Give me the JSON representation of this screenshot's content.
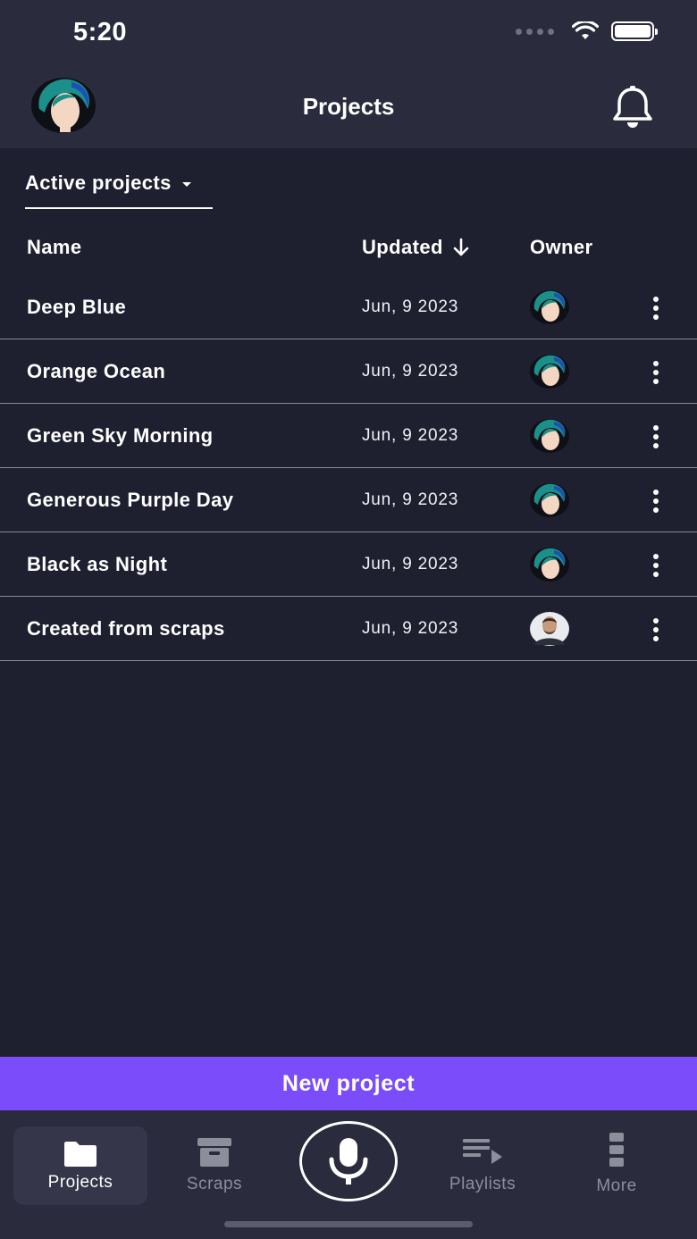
{
  "status_bar": {
    "time": "5:20"
  },
  "header": {
    "title": "Projects"
  },
  "filter": {
    "label": "Active projects"
  },
  "table": {
    "columns": {
      "name": "Name",
      "updated": "Updated",
      "owner": "Owner"
    },
    "rows": [
      {
        "name": "Deep Blue",
        "updated": "Jun, 9 2023",
        "owner": "teal-hair-avatar"
      },
      {
        "name": "Orange Ocean",
        "updated": "Jun, 9 2023",
        "owner": "teal-hair-avatar"
      },
      {
        "name": "Green Sky Morning",
        "updated": "Jun, 9 2023",
        "owner": "teal-hair-avatar"
      },
      {
        "name": "Generous Purple Day",
        "updated": "Jun, 9 2023",
        "owner": "teal-hair-avatar"
      },
      {
        "name": "Black as Night",
        "updated": "Jun, 9 2023",
        "owner": "teal-hair-avatar"
      },
      {
        "name": "Created from scraps",
        "updated": "Jun, 9 2023",
        "owner": "photo-avatar"
      }
    ]
  },
  "new_project_label": "New project",
  "bottom_nav": {
    "items": [
      {
        "label": "Projects",
        "icon": "folder-icon",
        "active": true
      },
      {
        "label": "Scraps",
        "icon": "archive-box-icon",
        "active": false
      },
      {
        "label": "Playlists",
        "icon": "playlist-icon",
        "active": false
      },
      {
        "label": "More",
        "icon": "more-vertical-icon",
        "active": false
      }
    ],
    "record_icon": "microphone-icon"
  },
  "colors": {
    "background": "#1e1f2f",
    "header": "#2a2b3d",
    "accent": "#7b4dfa",
    "inactive": "#8d8e9b"
  }
}
